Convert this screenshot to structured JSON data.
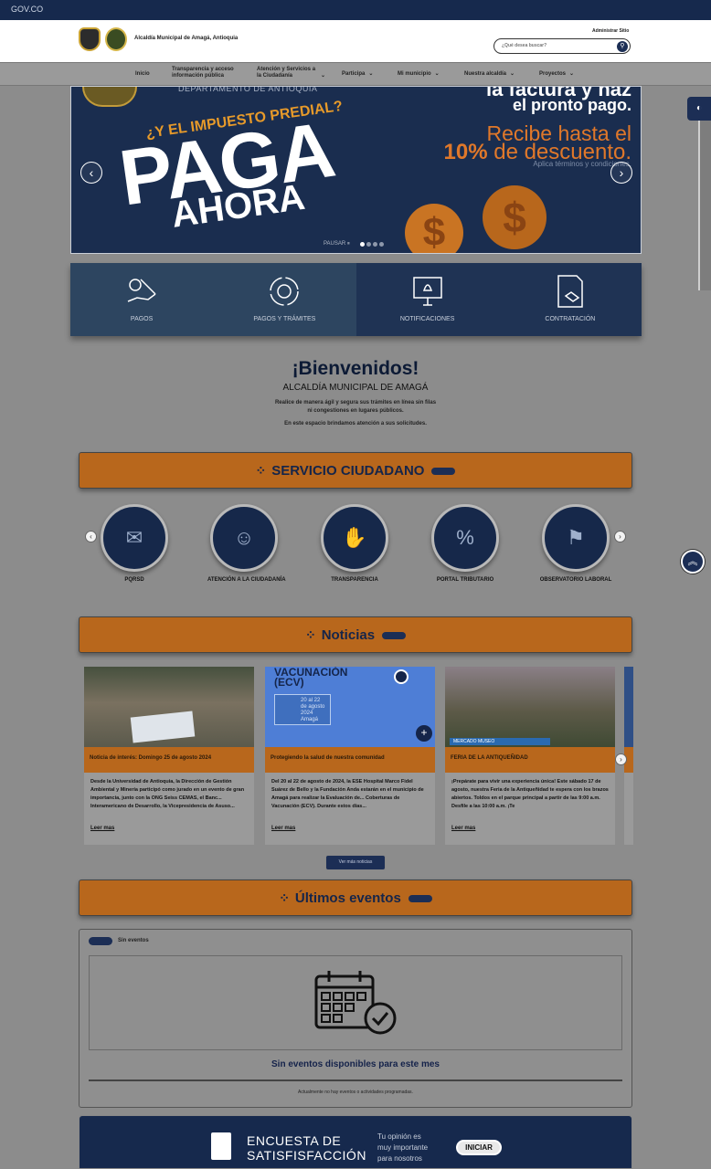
{
  "gov_bar": {
    "label": "GOV.CO"
  },
  "header": {
    "org_name": "Alcaldía Municipal de Amagá, Antioquia",
    "admin_link": "Administrar Sitio",
    "search_placeholder": "¿Qué desea buscar?"
  },
  "nav": {
    "items": [
      {
        "label": "Inicio"
      },
      {
        "label": "Transparencia y acceso información pública"
      },
      {
        "label": "Atención y Servicios a la Ciudadanía"
      },
      {
        "label": "Participa"
      },
      {
        "label": "Mi municipio"
      },
      {
        "label": "Nuestra alcaldía"
      },
      {
        "label": "Proyectos"
      }
    ]
  },
  "slider": {
    "department": "DEPARTAMENTO DE ANTIOQUIA",
    "question": "¿Y EL IMPUESTO PREDIAL?",
    "headline": "PAGA",
    "headline2": "AHORA",
    "right_1": "la factura y haz",
    "right_2": "el pronto pago.",
    "right_3": "Recibe hasta el",
    "right_4_pct": "10%",
    "right_4_rest": " de descuento.",
    "right_5": "Aplica términos y condiciones.",
    "pause": "PAUSAR",
    "slides": 4,
    "active_slide": 1
  },
  "quick_access": [
    {
      "label": "PAGOS",
      "icon": "payment-hand-icon"
    },
    {
      "label": "PAGOS Y TRÁMITES",
      "icon": "gear-cycle-icon"
    },
    {
      "label": "NOTIFICACIONES",
      "icon": "monitor-bell-icon"
    },
    {
      "label": "CONTRATACIÓN",
      "icon": "contract-handshake-icon"
    }
  ],
  "welcome": {
    "title": "¡Bienvenidos!",
    "subtitle": "ALCALDÍA MUNICIPAL DE AMAGÁ",
    "line1": "Realice de manera ágil y segura sus trámites en línea sin filas",
    "line2": "ni congestiones en lugares públicos.",
    "line3": "En este espacio brindamos atención a sus solicitudes."
  },
  "citizen_service": {
    "title": "SERVICIO CIUDADANO",
    "items": [
      {
        "label": "PQRSD"
      },
      {
        "label": "ATENCIÓN A LA CIUDADANÍA"
      },
      {
        "label": "TRANSPARENCIA"
      },
      {
        "label": "PORTAL TRIBUTARIO"
      },
      {
        "label": "OBSERVATORIO LABORAL"
      }
    ]
  },
  "news": {
    "title": "Noticias",
    "items": [
      {
        "title": "Noticia de interés: Domingo 25 de agosto 2024",
        "desc": "Desde la Universidad de Antioquia, la Dirección de Gestión Ambiental y Minería participó como jurado en un evento de gran importancia, junto con la ONG Seiss CEMAS, el Banc... Interamericano de Desarrollo, la Vicepresidencia de Asuso...",
        "read_more": "Leer mas"
      },
      {
        "title": "Protegiendo la salud de nuestra comunidad",
        "desc": "Del 20 al 22 de agosto de 2024, la ESE Hospital Marco Fidel Suárez de Bello y la Fundación Anda estarán en el municipio de Amagá para realizar la Evaluación de... Coberturas de Vacunación (ECV). Durante estos días...",
        "read_more": "Leer mas",
        "image_title": "VACUNACIÓN (ECV)",
        "image_dates": "20 al 22 de agosto 2024 Amagá"
      },
      {
        "title": "FERIA DE LA ANTIQUEÑIDAD",
        "desc": "¡Prepárate para vivir una experiencia única! Este sábado 17 de agosto, nuestra Feria de la Antiqueñidad te espera con los brazos abiertos. Toldos en el parque principal a partir de las 9:00 a.m. Desfile a las 10:00 a.m. ¡Te",
        "read_more": "Leer mas",
        "image_caption": "MERCADO MUSEO"
      }
    ],
    "more_button": "Ver más noticias"
  },
  "events": {
    "title": "Últimos eventos",
    "tag": "Sin eventos",
    "message": "Sin eventos disponibles para este mes",
    "sub": "Actualmente no hay eventos o actividades programadas."
  },
  "survey": {
    "title_1": "ENCUESTA DE",
    "title_2": "SATISFISFACCIÓN",
    "sub_1": "Tu opinión es",
    "sub_2": "muy importante",
    "sub_3": "para nosotros",
    "button": "INICIAR"
  },
  "colors": {
    "navy": "#16294d",
    "orange": "#b8671c",
    "accent_orange": "#e0782a"
  }
}
